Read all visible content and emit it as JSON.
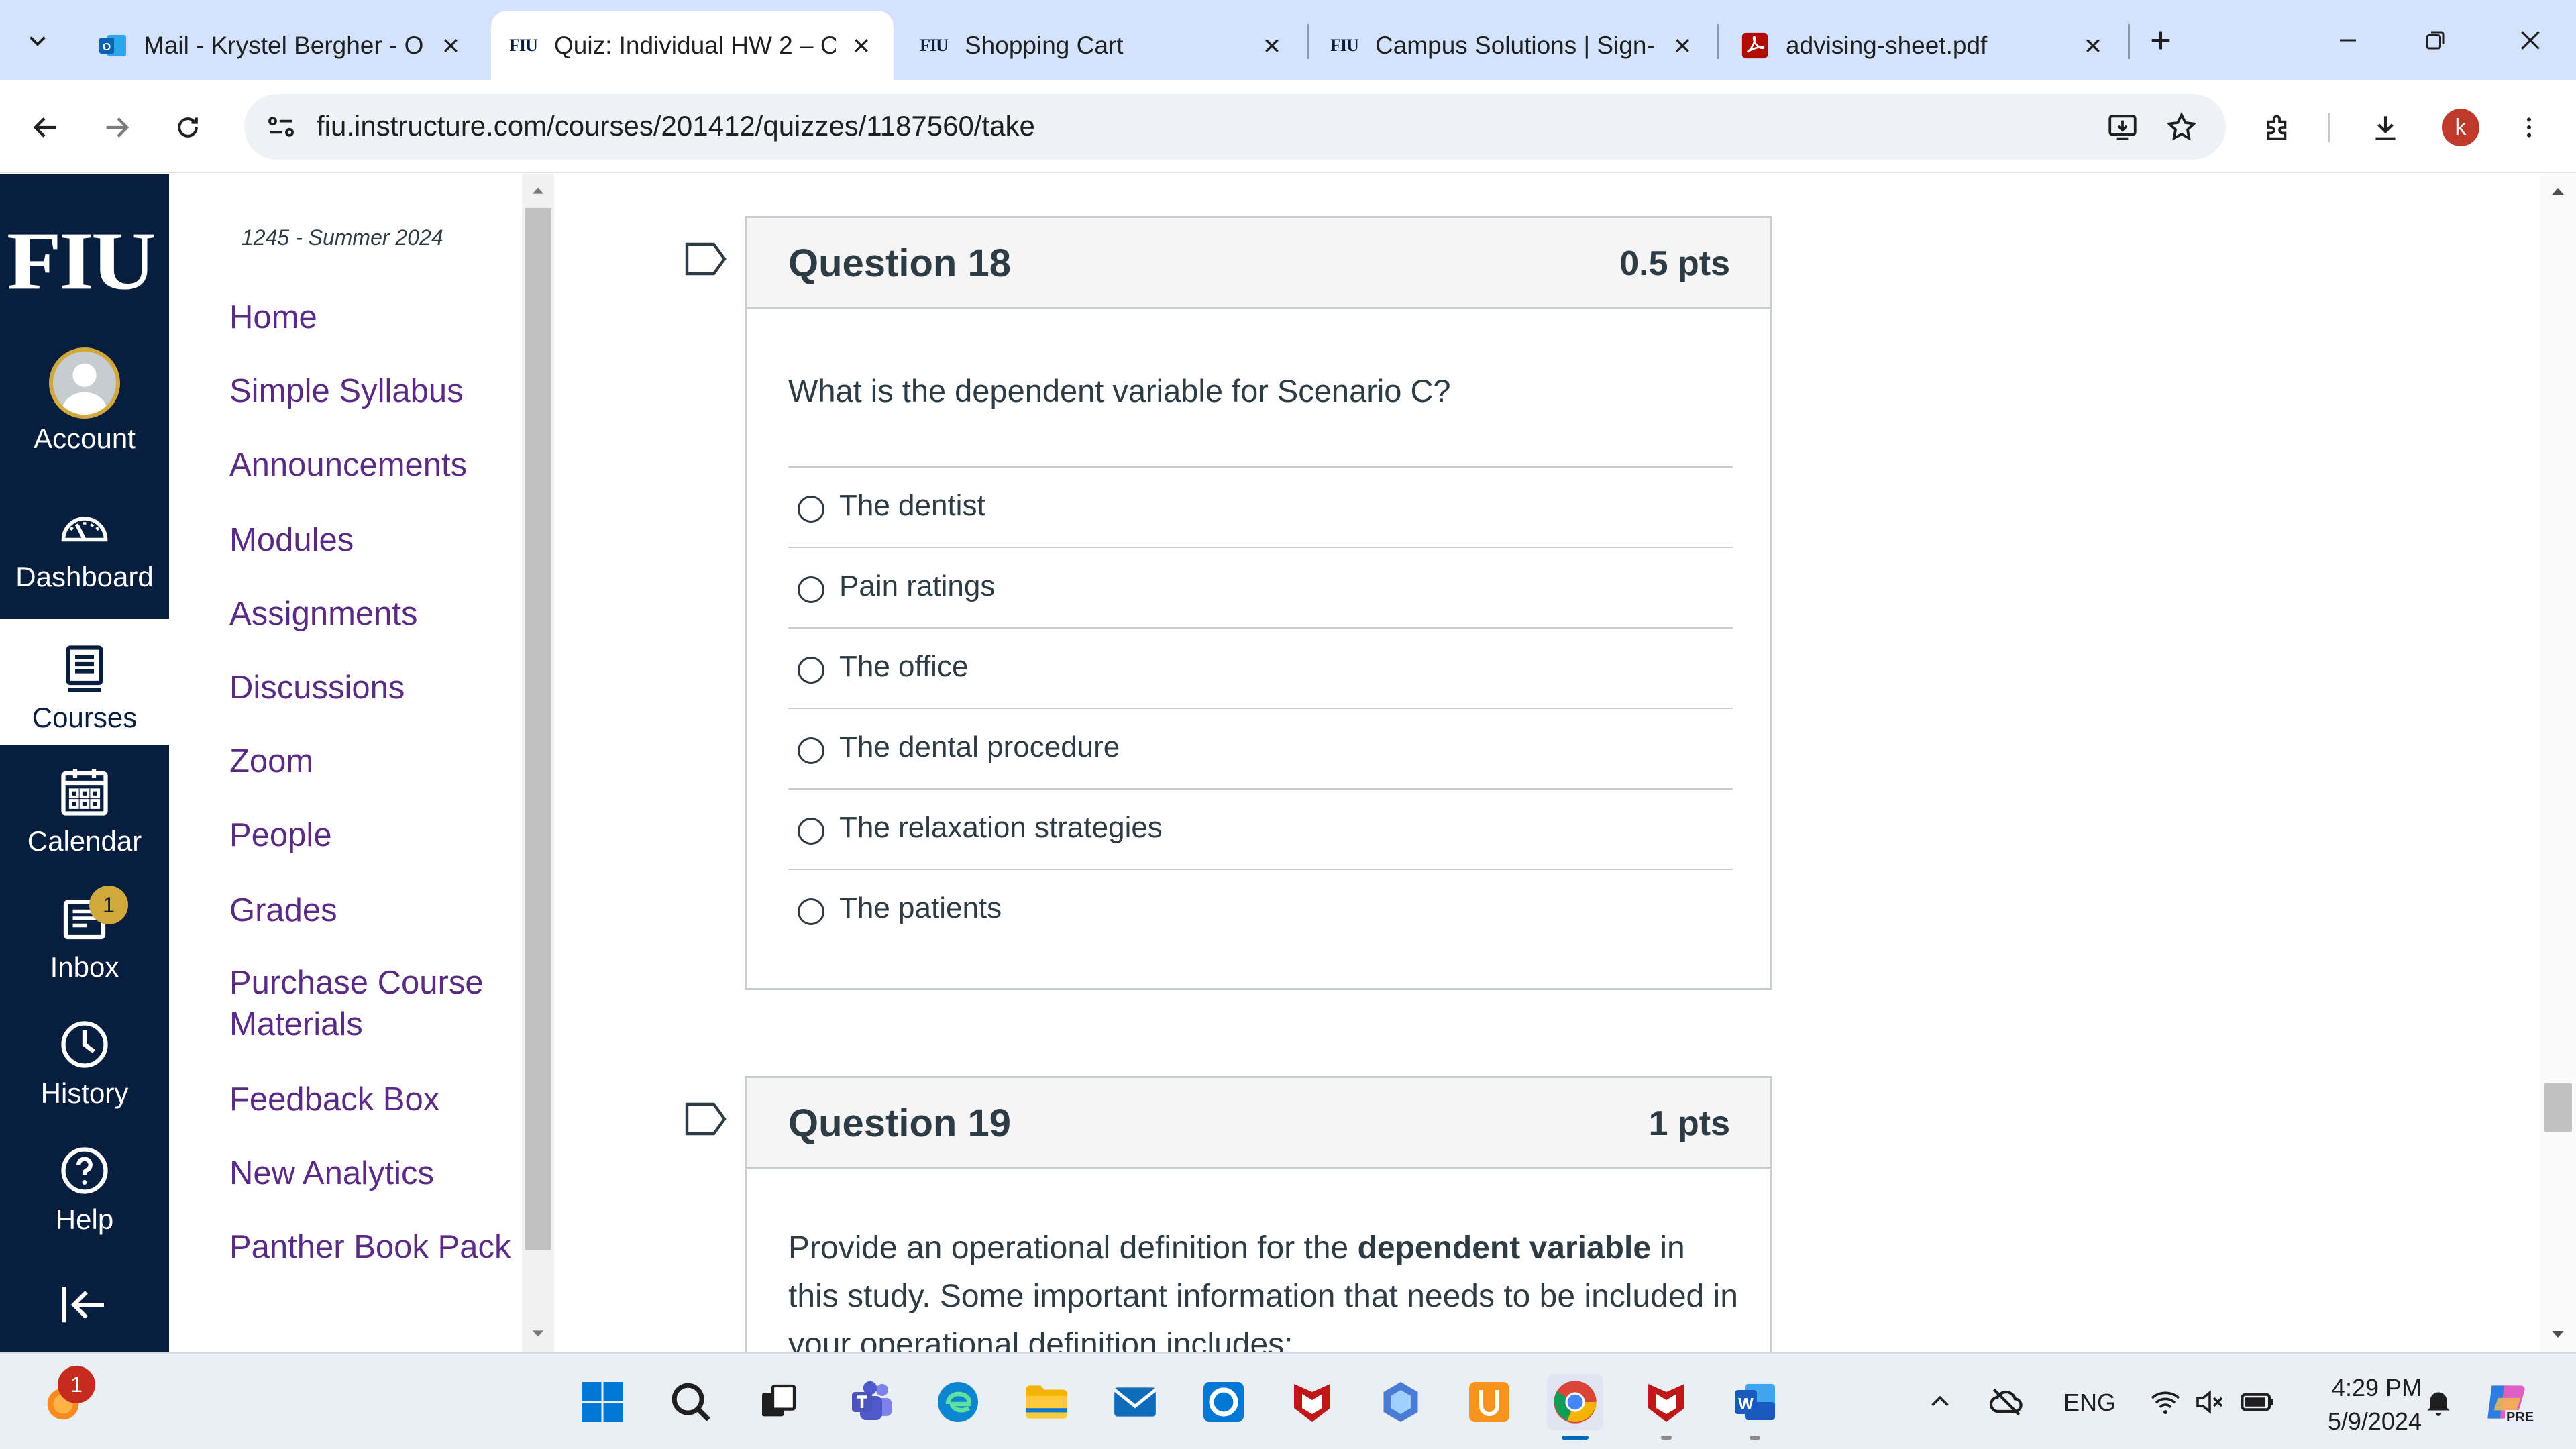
{
  "browser": {
    "tabs": [
      {
        "title": "Mail - Krystel Bergher - O",
        "icon": "outlook-icon"
      },
      {
        "title": "Quiz: Individual HW 2 – C",
        "icon": "fiu-favicon",
        "active": true
      },
      {
        "title": "Shopping Cart",
        "icon": "fiu-favicon"
      },
      {
        "title": "Campus Solutions | Sign-",
        "icon": "fiu-favicon"
      },
      {
        "title": "advising-sheet.pdf",
        "icon": "pdf-icon"
      }
    ],
    "favicon_text": "FIU",
    "url": "fiu.instructure.com/courses/201412/quizzes/1187560/take",
    "profile_initial": "k"
  },
  "global_nav": {
    "logo": "FIU",
    "items": [
      {
        "label": "Account",
        "icon": "avatar-icon"
      },
      {
        "label": "Dashboard",
        "icon": "dashboard-icon"
      },
      {
        "label": "Courses",
        "icon": "courses-icon",
        "active": true
      },
      {
        "label": "Calendar",
        "icon": "calendar-icon"
      },
      {
        "label": "Inbox",
        "icon": "inbox-icon",
        "badge": "1"
      },
      {
        "label": "History",
        "icon": "history-icon"
      },
      {
        "label": "Help",
        "icon": "help-icon"
      }
    ]
  },
  "course_nav": {
    "term": "1245 - Summer 2024",
    "links": [
      "Home",
      "Simple Syllabus",
      "Announcements",
      "Modules",
      "Assignments",
      "Discussions",
      "Zoom",
      "People",
      "Grades",
      "Purchase Course Materials",
      "Feedback Box",
      "New Analytics",
      "Panther Book Pack"
    ]
  },
  "questions": [
    {
      "title": "Question 18",
      "points": "0.5 pts",
      "text": "What is the dependent variable for Scenario C?",
      "answers": [
        "The dentist",
        "Pain ratings",
        "The office",
        "The dental procedure",
        "The relaxation strategies",
        "The patients"
      ]
    },
    {
      "title": "Question 19",
      "points": "1 pts",
      "text_before": "Provide an operational definition for the ",
      "text_bold": "dependent variable",
      "text_after": " in this study. Some important information that needs to be included in your operational definition includes:"
    }
  ],
  "taskbar": {
    "notification_count": "1",
    "language": "ENG",
    "time": "4:29 PM",
    "date": "5/9/2024",
    "copilot_label": "PRE"
  },
  "colors": {
    "canvas_nav": "#081e3f",
    "link_purple": "#5b2a86",
    "badge_gold": "#d1a93a",
    "tab_strip": "#d3e3fd"
  }
}
